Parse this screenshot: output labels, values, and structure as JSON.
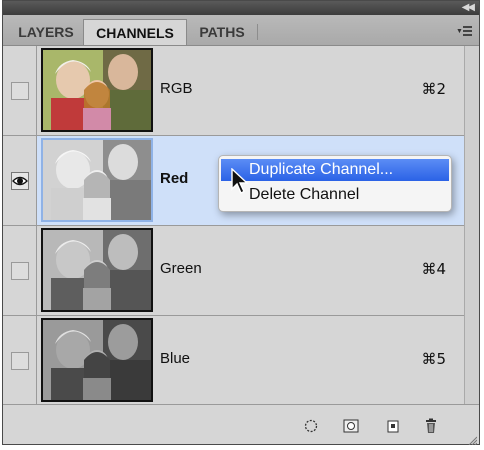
{
  "panel": {
    "collapse_icon": "double-left-arrow-icon",
    "menu_icon": "panel-menu-icon"
  },
  "tabs": [
    {
      "label": "LAYERS",
      "active": false
    },
    {
      "label": "CHANNELS",
      "active": true
    },
    {
      "label": "PATHS",
      "active": false
    }
  ],
  "channels": [
    {
      "name": "RGB",
      "shortcut": "⌘2",
      "visible": false,
      "selected": false
    },
    {
      "name": "Red",
      "shortcut": "",
      "visible": true,
      "selected": true
    },
    {
      "name": "Green",
      "shortcut": "⌘4",
      "visible": false,
      "selected": false
    },
    {
      "name": "Blue",
      "shortcut": "⌘5",
      "visible": false,
      "selected": false
    }
  ],
  "context_menu": {
    "items": [
      {
        "label": "Duplicate Channel...",
        "highlighted": true
      },
      {
        "label": "Delete Channel",
        "highlighted": false
      }
    ]
  },
  "footer": {
    "buttons": [
      "load-selection-icon",
      "save-selection-icon",
      "new-channel-icon",
      "delete-channel-icon"
    ]
  },
  "colors": {
    "selection": "#cfe0f9",
    "menu_highlight": "#2b62e6"
  }
}
